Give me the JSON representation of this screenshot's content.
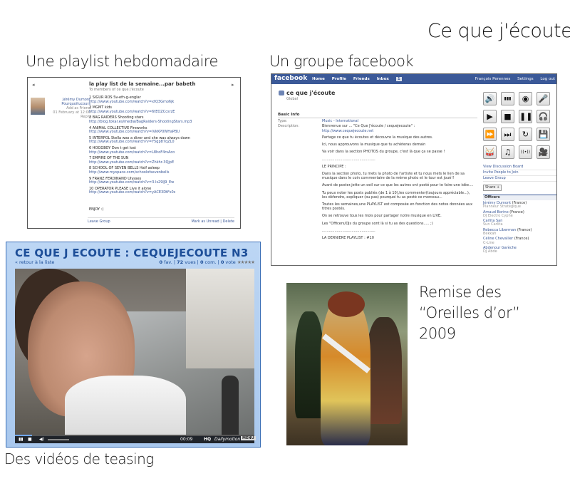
{
  "titles": {
    "main": "Ce que j'écoute",
    "playlist": "Une playlist hebdomadaire",
    "facebook": "Un groupe facebook",
    "videos": "Des vidéos de teasing",
    "award_line1": "Remise des",
    "award_line2": "“Oreilles d’or”",
    "award_line3": "2009"
  },
  "playlist": {
    "title": "la play list de la semaine...par babeth",
    "members": "To members of ce que j'écoute",
    "profile_name_1": "Jérémy Dumont",
    "profile_name_2": "Pourquoitucours",
    "profile_sub_1": "Add as Friend",
    "profile_date": "01 February at 12:00",
    "profile_reply": "Reply",
    "items": [
      {
        "t": "1 SIGUR ROS Sv-efn-g-englar",
        "u": "http://www.youtube.com/watch?v=xtQ3Gmo6jk"
      },
      {
        "t": "2 MGMT kids",
        "u": "http://www.youtube.com/watch?v=6tEOZCcsrzE"
      },
      {
        "t": "3 BAG RAIDERS Shooting stars",
        "u": "http://blog.tokar.es/media/BagRaiders-ShootingStars.mp3"
      },
      {
        "t": "4 ANIMAL COLLECTIVE Fireworks",
        "u": "http://www.youtube.com/watch?v=iVkKP0WHaPBU"
      },
      {
        "t": "5 INTERPOL Stella was a diver and she was always down",
        "u": "http://www.youtube.com/watch?v=Y5gp87qZL0"
      },
      {
        "t": "6 HOGGBOY Don t get lost",
        "u": "http://www.youtube.com/watch?v=L8hoF4rsAco"
      },
      {
        "t": "7 EMPIRE OF THE SUN",
        "u": "http://www.youtube.com/watch?v=Zhkhr-3QjpE"
      },
      {
        "t": "8 SCHOOL OF SEVEN BELLS Half asleep",
        "u": "http://www.myspace.com/schoolofsevenbells"
      },
      {
        "t": "9 FRANZ FERDINAND Ulysses",
        "u": "http://www.youtube.com/watch?v=3-ls29lJ9_Ew"
      },
      {
        "t": "10 OPERATOR PLEASE Live it alone",
        "u": "http://www.youtube.com/watch?v=yACE3DtFs0s"
      }
    ],
    "enjoy": "ENJOY :)",
    "leave_group": "Leave Group",
    "mark_unread": "Mark as Unread | Delete"
  },
  "facebook": {
    "logo": "facebook",
    "nav": [
      "Home",
      "Profile",
      "Friends",
      "Inbox"
    ],
    "inbox_count": "1",
    "user": "François Perennes",
    "settings": "Settings",
    "logout": "Log out",
    "group_name": "ce que j'écoute",
    "group_sub": "Global",
    "basic_info": "Basic Info",
    "type_label": "Type:",
    "type_value": "Music - International",
    "desc_label": "Description:",
    "desc_value": "Bienvenue sur ... \"Ce Que J'écoute / cequejecoute\" :",
    "desc_url": "http://www.cequejecoute.net",
    "paragraphs": [
      "Partage ce que tu écoutes et découvre la musique des autres.",
      "Ici, nous approuvons la musique que tu achèteras demain",
      "Va voir dans la section PHOTOS du groupe, c'est là que ça se passe !",
      "...............................................",
      "LE PRINCIPE :",
      "Dans la section photo, tu mets la photo de l'artiste et tu nous mets le lien de sa musique dans le coin commentaire de la même photo et le tour est joué!!",
      "Avant de poster,jette un oeil sur ce que les autres ont posté pour te faire une idée....",
      "Tu peux noter les posts publiés (de 1 à 10),les commenter(toujours appréciable...), les défendre, expliquer (ou pas) pourquoi tu as posté ce morceau...",
      "Toutes les semaines,une PLAYLIST est composée en fonction des notes données aux titres postés.",
      "On se retrouve tous les mois pour partager notre musique en LIVE.",
      "Les \"Officers/DJs du groupe sont là si tu as des questions..... ;)",
      "...............................................",
      "LA DERNIERE PLAYLIST : #10"
    ],
    "icons": [
      "speaker-icon",
      "equalizer-icon",
      "vinyl-icon",
      "microphone-icon",
      "play-icon",
      "stop-icon",
      "pause-icon",
      "headphones-icon",
      "fast-forward-icon",
      "skip-icon",
      "repeat-icon",
      "floppy-icon",
      "drum-icon",
      "music-note-icon",
      "radio-icon",
      "camera-icon"
    ],
    "icon_glyphs": [
      "🔊",
      "▮▮▮",
      "◉",
      "🎤",
      "▶",
      "■",
      "❚❚",
      "🎧",
      "⏩",
      "⏭",
      "↻",
      "💾",
      "🥁",
      "♫",
      "((•))",
      "🎥"
    ],
    "side_links": [
      "View Discussion Board",
      "Invite People to Join",
      "Leave Group"
    ],
    "share": "Share",
    "share_plus": "+",
    "officers_h": "Officers",
    "officers": [
      {
        "n": "Jérémy Dumont",
        "c": " (France)",
        "r": "Planneur Stratégique"
      },
      {
        "n": "Arnaud Borino",
        "c": " (France)",
        "r": "DJ Electro Cyphe"
      },
      {
        "n": "Carlita San",
        "c": "",
        "r": "Sun Carlita"
      },
      {
        "n": "Rebecca Liberman",
        "c": " (France)",
        "r": "Bekkah"
      },
      {
        "n": "Céline Chevallier",
        "c": " (France)",
        "r": "C-Line"
      },
      {
        "n": "Abdenour Garèche",
        "c": "",
        "r": "DJ Abde"
      }
    ]
  },
  "video": {
    "title": "CE QUE J ECOUTE : CEQUEJECOUTE N3",
    "back": "« retour à la liste",
    "fav": "0",
    "fav_label": " fav. | ",
    "views": "72",
    "views_label": " vues | ",
    "comments": "0",
    "comments_label": " com. | ",
    "votes": "0",
    "votes_label": " vote ",
    "stars": "★★★★★",
    "time": "00:09",
    "hq": "HQ",
    "brand": "Dailymotion",
    "menu": "MENU",
    "progress": 0.07
  }
}
